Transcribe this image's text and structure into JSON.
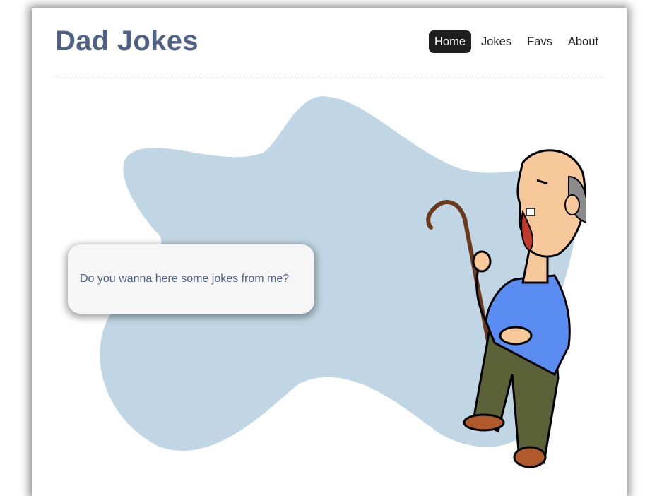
{
  "header": {
    "brand": "Dad Jokes",
    "nav": [
      {
        "label": "Home",
        "active": true
      },
      {
        "label": "Jokes",
        "active": false
      },
      {
        "label": "Favs",
        "active": false
      },
      {
        "label": "About",
        "active": false
      }
    ]
  },
  "hero": {
    "speech_text": "Do you wanna here some jokes from me?",
    "illustration": "laughing-old-man-with-cane",
    "blob_color": "#c0d6e4"
  },
  "colors": {
    "brand": "#4f6285",
    "nav_active_bg": "#1e1e1e",
    "nav_active_text": "#ffffff"
  }
}
